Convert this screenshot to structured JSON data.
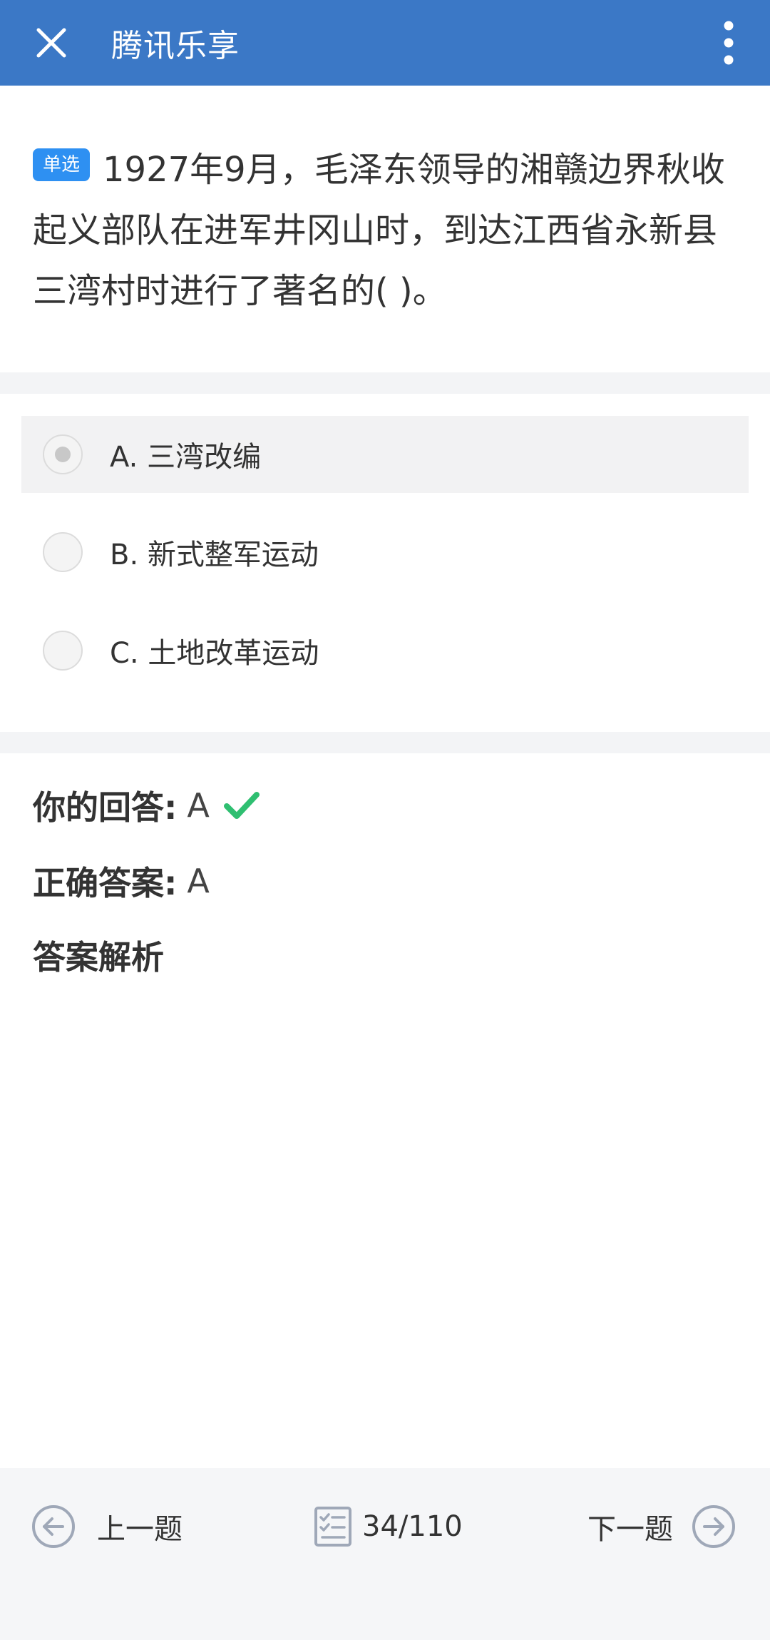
{
  "app": {
    "title": "腾讯乐享"
  },
  "question": {
    "type_badge": "单选",
    "text": "1927年9月，毛泽东领导的湘赣边界秋收起义部队在进军井冈山时，到达江西省永新县三湾村时进行了著名的( )。"
  },
  "options": [
    {
      "label": "A. 三湾改编",
      "selected": true
    },
    {
      "label": "B. 新式整军运动",
      "selected": false
    },
    {
      "label": "C. 土地改革运动",
      "selected": false
    }
  ],
  "answer": {
    "yours_label": "你的回答:",
    "yours_value": "A",
    "correct_label": "正确答案:",
    "correct_value": "A",
    "analysis_label": "答案解析"
  },
  "footer": {
    "prev_label": "上一题",
    "progress": "34/110",
    "next_label": "下一题"
  },
  "colors": {
    "header": "#3b78c6",
    "badge": "#2e90f2",
    "correct": "#2fbf71"
  },
  "icons": [
    "close-icon",
    "more-vertical-icon",
    "arrow-left-circle-icon",
    "question-list-icon",
    "arrow-right-circle-icon",
    "check-icon"
  ]
}
